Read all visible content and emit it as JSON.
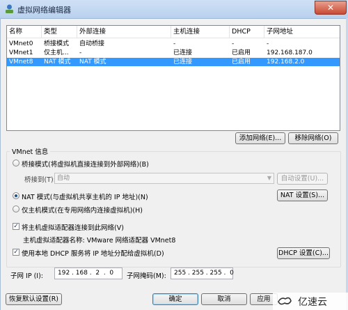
{
  "window": {
    "title": "虚拟网络编辑器",
    "close_glyph": "✕"
  },
  "table": {
    "headers": [
      "名称",
      "类型",
      "外部连接",
      "主机连接",
      "DHCP",
      "子网地址"
    ],
    "rows": [
      [
        "VMnet0",
        "桥接模式",
        "自动桥接",
        "-",
        "-",
        "-"
      ],
      [
        "VMnet1",
        "仅主机...",
        "-",
        "已连接",
        "已启用",
        "192.168.187.0"
      ],
      [
        "VMnet8",
        "NAT 模式",
        "NAT 模式",
        "已连接",
        "已启用",
        "192.168.2.0"
      ]
    ],
    "selected_row": 2
  },
  "buttons": {
    "add_network": "添加网络(E)...",
    "remove_network": "移除网络(O)",
    "auto_settings": "自动设置(U)...",
    "nat_settings": "NAT 设置(S)...",
    "dhcp_settings": "DHCP 设置(C)...",
    "restore_defaults": "恢复默认设置(R)",
    "ok": "确定",
    "cancel": "取消",
    "apply": "应用"
  },
  "vmnet_info": {
    "title": "VMnet 信息",
    "bridged_label": "桥接模式(将虚拟机直接连接到外部网络)(B)",
    "bridged_to_label": "桥接到(T):",
    "bridged_to_value": "自动",
    "nat_label": "NAT 模式(与虚拟机共享主机的 IP 地址)(N)",
    "host_only_label": "仅主机模式(在专用网络内连接虚拟机)(H)",
    "selected_mode": "nat",
    "connect_adapter_label": "将主机虚拟适配器连接到此网络(V)",
    "adapter_name_text": "主机虚拟适配器名称: VMware 网络适配器 VMnet8",
    "use_dhcp_label": "使用本地 DHCP 服务将 IP 地址分配给虚拟机(D)",
    "connect_adapter_checked": true,
    "use_dhcp_checked": true,
    "check_glyph": "✓"
  },
  "subnet": {
    "ip_label": "子网 IP (I):",
    "ip_value": "192 . 168 .  2  .  0",
    "mask_label": "子网掩码(M):",
    "mask_value": "255 . 255 . 255 .  0"
  },
  "watermark": {
    "text": "亿速云"
  }
}
